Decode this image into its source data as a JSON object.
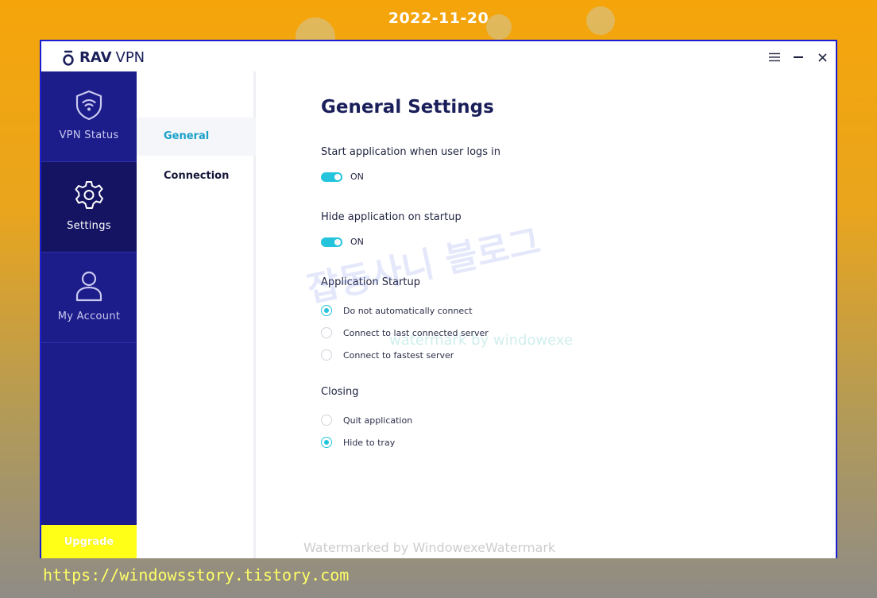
{
  "date_banner": "2022-11-20",
  "footer_url": "https://windowsstory.tistory.com",
  "window": {
    "brand": "RAV",
    "product": "VPN",
    "controls": {
      "menu_icon": "hamburger-icon",
      "minimize_icon": "minimize-icon",
      "close_icon": "close-icon"
    }
  },
  "sidebar": {
    "items": [
      {
        "label": "VPN Status",
        "icon": "shield-wifi-icon",
        "active": false
      },
      {
        "label": "Settings",
        "icon": "gear-icon",
        "active": true
      },
      {
        "label": "My Account",
        "icon": "user-icon",
        "active": false
      }
    ],
    "upgrade_label": "Upgrade"
  },
  "subnav": {
    "items": [
      {
        "label": "General",
        "active": true
      },
      {
        "label": "Connection",
        "active": false
      }
    ]
  },
  "content": {
    "title": "General Settings",
    "start_on_login": {
      "label": "Start application when user logs in",
      "state": "ON"
    },
    "hide_on_startup": {
      "label": "Hide application on startup",
      "state": "ON"
    },
    "app_startup": {
      "label": "Application Startup",
      "options": [
        {
          "label": "Do not automatically connect",
          "checked": true
        },
        {
          "label": "Connect to last connected server",
          "checked": false
        },
        {
          "label": "Connect to fastest server",
          "checked": false
        }
      ]
    },
    "closing": {
      "label": "Closing",
      "options": [
        {
          "label": "Quit application",
          "checked": false
        },
        {
          "label": "Hide to tray",
          "checked": true
        }
      ]
    }
  },
  "watermarks": {
    "korean": "잡동사니 블로그",
    "english": "watermark by windowexe",
    "bottom": "Watermarked by WindowexeWatermark"
  },
  "colors": {
    "sidebar": "#1c1c8a",
    "sidebar_active": "#141463",
    "accent": "#23c4dc",
    "upgrade": "#ffff17",
    "title": "#1a1f5a",
    "window_border": "#1b1dd1"
  }
}
